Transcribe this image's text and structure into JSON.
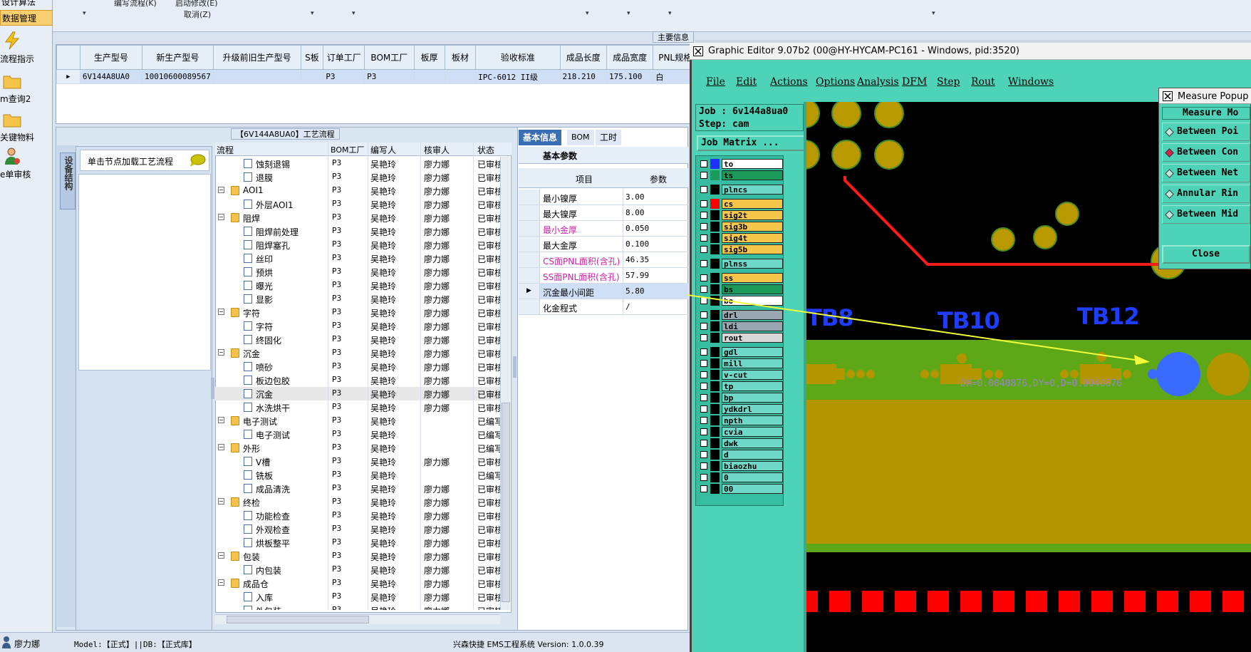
{
  "left_nav": {
    "top_items": [
      "设计算法",
      "数据管理"
    ],
    "items": [
      {
        "label": "流程指示",
        "icon": "lightning-icon"
      },
      {
        "label": "m查询2",
        "icon": "folder-icon"
      },
      {
        "label": "关键物料",
        "icon": "folder-icon"
      },
      {
        "label": "e单审核",
        "icon": "user-icon"
      }
    ]
  },
  "toolbar": {
    "items": [
      "编写流程(K)",
      "启动修改(E)",
      "取消(Z)"
    ]
  },
  "main_section": {
    "label": "主要信息",
    "columns": [
      "生产型号",
      "新生产型号",
      "升级前旧生产型号",
      "S板",
      "订单工厂",
      "BOM工厂",
      "板厚",
      "板材",
      "验收标准",
      "成品长度",
      "成品宽度",
      "PNL规格"
    ],
    "rows": [
      [
        "6V144A8UA0",
        "10010600089567",
        "",
        "",
        "P3",
        "P3",
        "",
        "",
        "IPC-6012 II级",
        "218.210",
        "175.100",
        "白"
      ]
    ]
  },
  "flow_panel": {
    "title": "【6V144A8UA0】工艺流程",
    "side_tab": "设备结构",
    "node_hint": "单击节点加载工艺流程",
    "columns": [
      "流程",
      "BOM工厂",
      "编写人",
      "核审人",
      "状态"
    ],
    "rows": [
      {
        "name": "蚀刻退锡",
        "level": 2,
        "kind": "doc",
        "bom": "P3",
        "writer": "吴艳玲",
        "reviewer": "廖力娜",
        "status": "已审核"
      },
      {
        "name": "退膜",
        "level": 2,
        "kind": "doc",
        "bom": "P3",
        "writer": "吴艳玲",
        "reviewer": "廖力娜",
        "status": "已审核"
      },
      {
        "name": "AOI1",
        "level": 1,
        "kind": "folder",
        "bom": "P3",
        "writer": "吴艳玲",
        "reviewer": "廖力娜",
        "status": "已审核"
      },
      {
        "name": "外层AOI1",
        "level": 2,
        "kind": "doc",
        "bom": "P3",
        "writer": "吴艳玲",
        "reviewer": "廖力娜",
        "status": "已审核"
      },
      {
        "name": "阻焊",
        "level": 1,
        "kind": "folder",
        "bom": "P3",
        "writer": "吴艳玲",
        "reviewer": "廖力娜",
        "status": "已审核"
      },
      {
        "name": "阻焊前处理",
        "level": 2,
        "kind": "doc",
        "bom": "P3",
        "writer": "吴艳玲",
        "reviewer": "廖力娜",
        "status": "已审核"
      },
      {
        "name": "阻焊塞孔",
        "level": 2,
        "kind": "doc",
        "bom": "P3",
        "writer": "吴艳玲",
        "reviewer": "廖力娜",
        "status": "已审核"
      },
      {
        "name": "丝印",
        "level": 2,
        "kind": "doc",
        "bom": "P3",
        "writer": "吴艳玲",
        "reviewer": "廖力娜",
        "status": "已审核"
      },
      {
        "name": "预烘",
        "level": 2,
        "kind": "doc",
        "bom": "P3",
        "writer": "吴艳玲",
        "reviewer": "廖力娜",
        "status": "已审核"
      },
      {
        "name": "曝光",
        "level": 2,
        "kind": "doc",
        "bom": "P3",
        "writer": "吴艳玲",
        "reviewer": "廖力娜",
        "status": "已审核"
      },
      {
        "name": "显影",
        "level": 2,
        "kind": "doc",
        "bom": "P3",
        "writer": "吴艳玲",
        "reviewer": "廖力娜",
        "status": "已审核"
      },
      {
        "name": "字符",
        "level": 1,
        "kind": "folder",
        "bom": "P3",
        "writer": "吴艳玲",
        "reviewer": "廖力娜",
        "status": "已审核"
      },
      {
        "name": "字符",
        "level": 2,
        "kind": "doc",
        "bom": "P3",
        "writer": "吴艳玲",
        "reviewer": "廖力娜",
        "status": "已审核"
      },
      {
        "name": "终固化",
        "level": 2,
        "kind": "doc",
        "bom": "P3",
        "writer": "吴艳玲",
        "reviewer": "廖力娜",
        "status": "已审核"
      },
      {
        "name": "沉金",
        "level": 1,
        "kind": "folder",
        "bom": "P3",
        "writer": "吴艳玲",
        "reviewer": "廖力娜",
        "status": "已审核"
      },
      {
        "name": "喷砂",
        "level": 2,
        "kind": "doc",
        "bom": "P3",
        "writer": "吴艳玲",
        "reviewer": "廖力娜",
        "status": "已审核"
      },
      {
        "name": "板边包胶",
        "level": 2,
        "kind": "doc",
        "bom": "P3",
        "writer": "吴艳玲",
        "reviewer": "廖力娜",
        "status": "已审核"
      },
      {
        "name": "沉金",
        "level": 2,
        "kind": "doc",
        "bom": "P3",
        "writer": "吴艳玲",
        "reviewer": "廖力娜",
        "status": "已审核",
        "selected": true
      },
      {
        "name": "水洗烘干",
        "level": 2,
        "kind": "doc",
        "bom": "P3",
        "writer": "吴艳玲",
        "reviewer": "廖力娜",
        "status": "已审核"
      },
      {
        "name": "电子测试",
        "level": 1,
        "kind": "folder",
        "bom": "P3",
        "writer": "吴艳玲",
        "reviewer": "",
        "status": "已编写"
      },
      {
        "name": "电子测试",
        "level": 2,
        "kind": "doc",
        "bom": "P3",
        "writer": "吴艳玲",
        "reviewer": "",
        "status": "已编写"
      },
      {
        "name": "外形",
        "level": 1,
        "kind": "folder",
        "bom": "P3",
        "writer": "吴艳玲",
        "reviewer": "",
        "status": "已编写"
      },
      {
        "name": "V槽",
        "level": 2,
        "kind": "doc",
        "bom": "P3",
        "writer": "吴艳玲",
        "reviewer": "廖力娜",
        "status": "已审核"
      },
      {
        "name": "铣板",
        "level": 2,
        "kind": "doc",
        "bom": "P3",
        "writer": "吴艳玲",
        "reviewer": "",
        "status": "已编写"
      },
      {
        "name": "成品清洗",
        "level": 2,
        "kind": "doc",
        "bom": "P3",
        "writer": "吴艳玲",
        "reviewer": "廖力娜",
        "status": "已审核"
      },
      {
        "name": "终检",
        "level": 1,
        "kind": "folder",
        "bom": "P3",
        "writer": "吴艳玲",
        "reviewer": "廖力娜",
        "status": "已审核"
      },
      {
        "name": "功能检查",
        "level": 2,
        "kind": "doc",
        "bom": "P3",
        "writer": "吴艳玲",
        "reviewer": "廖力娜",
        "status": "已审核"
      },
      {
        "name": "外观检查",
        "level": 2,
        "kind": "doc",
        "bom": "P3",
        "writer": "吴艳玲",
        "reviewer": "廖力娜",
        "status": "已审核"
      },
      {
        "name": "烘板整平",
        "level": 2,
        "kind": "doc",
        "bom": "P3",
        "writer": "吴艳玲",
        "reviewer": "廖力娜",
        "status": "已审核"
      },
      {
        "name": "包装",
        "level": 1,
        "kind": "folder",
        "bom": "P3",
        "writer": "吴艳玲",
        "reviewer": "廖力娜",
        "status": "已审核"
      },
      {
        "name": "内包装",
        "level": 2,
        "kind": "doc",
        "bom": "P3",
        "writer": "吴艳玲",
        "reviewer": "廖力娜",
        "status": "已审核"
      },
      {
        "name": "成品仓",
        "level": 1,
        "kind": "folder",
        "bom": "P3",
        "writer": "吴艳玲",
        "reviewer": "廖力娜",
        "status": "已审核"
      },
      {
        "name": "入库",
        "level": 2,
        "kind": "doc",
        "bom": "P3",
        "writer": "吴艳玲",
        "reviewer": "廖力娜",
        "status": "已审核"
      },
      {
        "name": "外包装",
        "level": 2,
        "kind": "doc",
        "bom": "P3",
        "writer": "吴艳玲",
        "reviewer": "廖力娜",
        "status": "已审核"
      }
    ]
  },
  "info_panel": {
    "tabs": [
      "基本信息",
      "BOM",
      "工时"
    ],
    "section": "基本参数",
    "columns": [
      "项目",
      "参数"
    ],
    "rows": [
      {
        "name": "最小镍厚",
        "value": "3.00",
        "highlight": false
      },
      {
        "name": "最大镍厚",
        "value": "8.00",
        "highlight": false
      },
      {
        "name": "最小金厚",
        "value": "0.050",
        "highlight": true
      },
      {
        "name": "最大金厚",
        "value": "0.100",
        "highlight": false
      },
      {
        "name": "CS面PNL面积(含孔)",
        "value": "46.35",
        "highlight": true
      },
      {
        "name": "SS面PNL面积(含孔)",
        "value": "57.99",
        "highlight": true
      },
      {
        "name": "沉金最小间距",
        "value": "5.80",
        "highlight": false,
        "selected": true
      },
      {
        "name": "化金程式",
        "value": "/",
        "highlight": false
      }
    ]
  },
  "status_bar": {
    "user": "廖力娜",
    "model": "Model:【正式】||DB:【正式库】",
    "app": "兴森快捷 EMS工程系统 Version: 1.0.0.39"
  },
  "graphic_editor": {
    "title": "Graphic Editor 9.07b2 (00@HY-HYCAM-PC161 - Windows, pid:3520)",
    "menu": [
      "File",
      "Edit",
      "Actions",
      "Options",
      "Analysis",
      "DFM",
      "Step",
      "Rout",
      "Windows"
    ],
    "job": "Job : 6v144a8ua0",
    "step": "Step: cam",
    "job_matrix": "Job Matrix ...",
    "layers": [
      {
        "name": "to",
        "color": "#1f2fff",
        "bg": "#ffffff"
      },
      {
        "name": "ts",
        "color": "#1b9a5a",
        "bg": "#1b9a5a"
      },
      {
        "name": "plncs",
        "color": "#000000",
        "bg": "#6fd8c8"
      },
      {
        "name": "cs",
        "color": "#ff0000",
        "bg": "#f6c64a"
      },
      {
        "name": "sig2t",
        "color": "#000000",
        "bg": "#f6c64a"
      },
      {
        "name": "sig3b",
        "color": "#000000",
        "bg": "#f6c64a"
      },
      {
        "name": "sig4t",
        "color": "#000000",
        "bg": "#f6c64a"
      },
      {
        "name": "sig5b",
        "color": "#000000",
        "bg": "#f6c64a"
      },
      {
        "name": "plnss",
        "color": "#000000",
        "bg": "#6fd8c8"
      },
      {
        "name": "ss",
        "color": "#000000",
        "bg": "#f6c64a"
      },
      {
        "name": "bs",
        "color": "#000000",
        "bg": "#1b9a5a"
      },
      {
        "name": "bo",
        "color": "#000000",
        "bg": "#ffffff"
      },
      {
        "name": "drl",
        "color": "#000000",
        "bg": "#9aa6b0"
      },
      {
        "name": "ldi",
        "color": "#000000",
        "bg": "#9aa6b0"
      },
      {
        "name": "rout",
        "color": "#000000",
        "bg": "#d8d8d8"
      },
      {
        "name": "gdl",
        "color": "#000000",
        "bg": "#6fd8c8"
      },
      {
        "name": "mill",
        "color": "#000000",
        "bg": "#6fd8c8"
      },
      {
        "name": "v-cut",
        "color": "#000000",
        "bg": "#6fd8c8"
      },
      {
        "name": "tp",
        "color": "#000000",
        "bg": "#6fd8c8"
      },
      {
        "name": "bp",
        "color": "#000000",
        "bg": "#6fd8c8"
      },
      {
        "name": "ydkdrl",
        "color": "#000000",
        "bg": "#6fd8c8"
      },
      {
        "name": "npth",
        "color": "#000000",
        "bg": "#6fd8c8"
      },
      {
        "name": "cvia",
        "color": "#000000",
        "bg": "#6fd8c8"
      },
      {
        "name": "dwk",
        "color": "#000000",
        "bg": "#6fd8c8"
      },
      {
        "name": "d",
        "color": "#000000",
        "bg": "#6fd8c8"
      },
      {
        "name": "biaozhu",
        "color": "#000000",
        "bg": "#6fd8c8"
      },
      {
        "name": "0",
        "color": "#000000",
        "bg": "#6fd8c8"
      },
      {
        "name": "00",
        "color": "#000000",
        "bg": "#6fd8c8"
      }
    ],
    "canvas_labels": [
      "TB8",
      "TB10",
      "TB12"
    ],
    "measure_text": "DX=0.0040876,DY=0,D=0.0040876"
  },
  "measure_popup": {
    "title": "Measure Popup",
    "header": "Measure Mo",
    "options": [
      "Between Poi",
      "Between Con",
      "Between Net",
      "Annular Rin",
      "Between Mid"
    ],
    "selected": 1,
    "close": "Close"
  }
}
